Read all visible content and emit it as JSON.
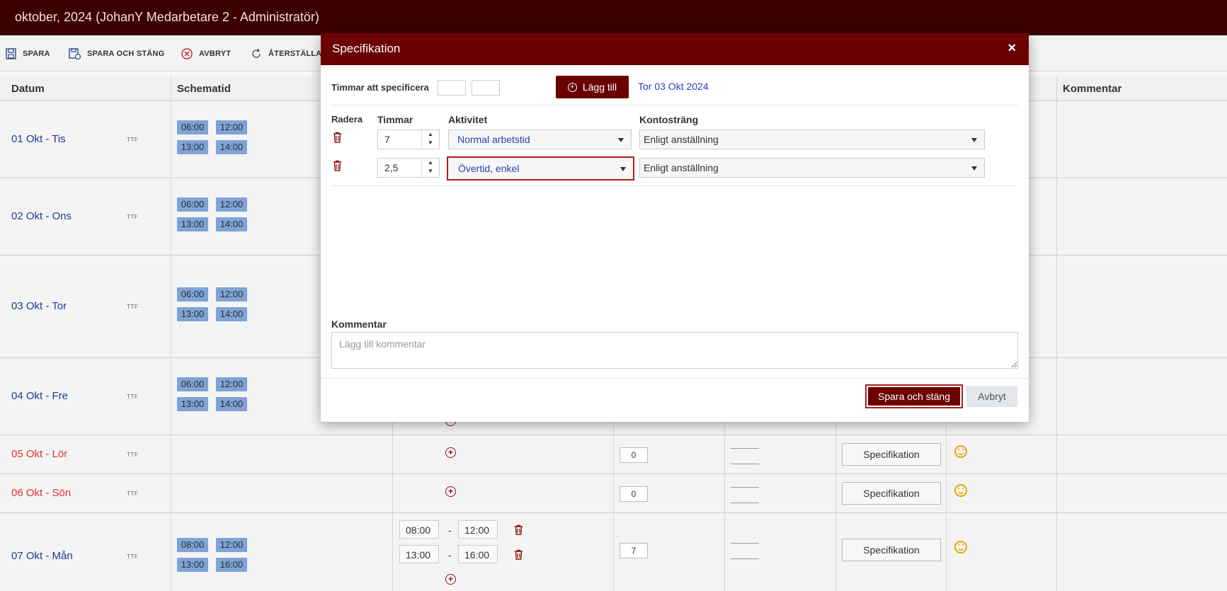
{
  "window": {
    "title": "oktober, 2024 (JohanY Medarbetare 2 - Administratör)"
  },
  "toolbar": {
    "save": "SPARA",
    "save_close": "SPARA OCH STÄNG",
    "cancel": "AVBRYT",
    "reset": "ÅTERSTÄLLA S"
  },
  "grid": {
    "headers": {
      "date": "Datum",
      "schedule": "Schematid",
      "comment": "Kommentar"
    },
    "ttf": "TTF",
    "rows": [
      {
        "date": "01 Okt - Tis",
        "chips": [
          "06:00",
          "12:00",
          "13:00",
          "14:00"
        ]
      },
      {
        "date": "02 Okt - Ons",
        "chips": [
          "06:00",
          "12:00",
          "13:00",
          "14:00"
        ]
      },
      {
        "date": "03 Okt - Tor",
        "chips": [
          "06:00",
          "12:00",
          "13:00",
          "14:00"
        ]
      },
      {
        "date": "04 Okt - Fre",
        "chips": [
          "06:00",
          "12:00",
          "13:00",
          "14:00"
        ]
      },
      {
        "date": "05 Okt - Lör",
        "hours": "0",
        "spec": "Specifikation"
      },
      {
        "date": "06 Okt - Sön",
        "hours": "0",
        "spec": "Specifikation"
      },
      {
        "date": "07 Okt - Mån",
        "chips": [
          "08:00",
          "12:00",
          "13:00",
          "16:00"
        ],
        "times": [
          "08:00",
          "12:00",
          "13:00",
          "16:00"
        ],
        "dash": "-",
        "hours": "7",
        "spec": "Specifikation"
      }
    ]
  },
  "modal": {
    "title": "Specifikation",
    "close": "×",
    "hours_to_specify_label": "Timmar att specificera",
    "add_button": "Lägg till",
    "date_link": "Tor 03 Okt 2024",
    "columns": {
      "delete": "Radera",
      "hours": "Timmar",
      "activity": "Aktivitet",
      "account": "Kontosträng"
    },
    "rows": [
      {
        "hours": "7",
        "activity": "Normal arbetstid",
        "account": "Enligt anställning"
      },
      {
        "hours": "2,5",
        "activity": "Övertid, enkel",
        "account": "Enligt anställning"
      }
    ],
    "comment_label": "Kommentar",
    "comment_placeholder": "Lägg till kommentar",
    "save_close": "Spara och stäng",
    "cancel": "Avbryt"
  },
  "colors": {
    "header": "#3b0000",
    "modal_header": "#6b0000",
    "accent_red": "#b31c1c",
    "chip": "#7fa3d6",
    "link": "#2b3fb0"
  }
}
